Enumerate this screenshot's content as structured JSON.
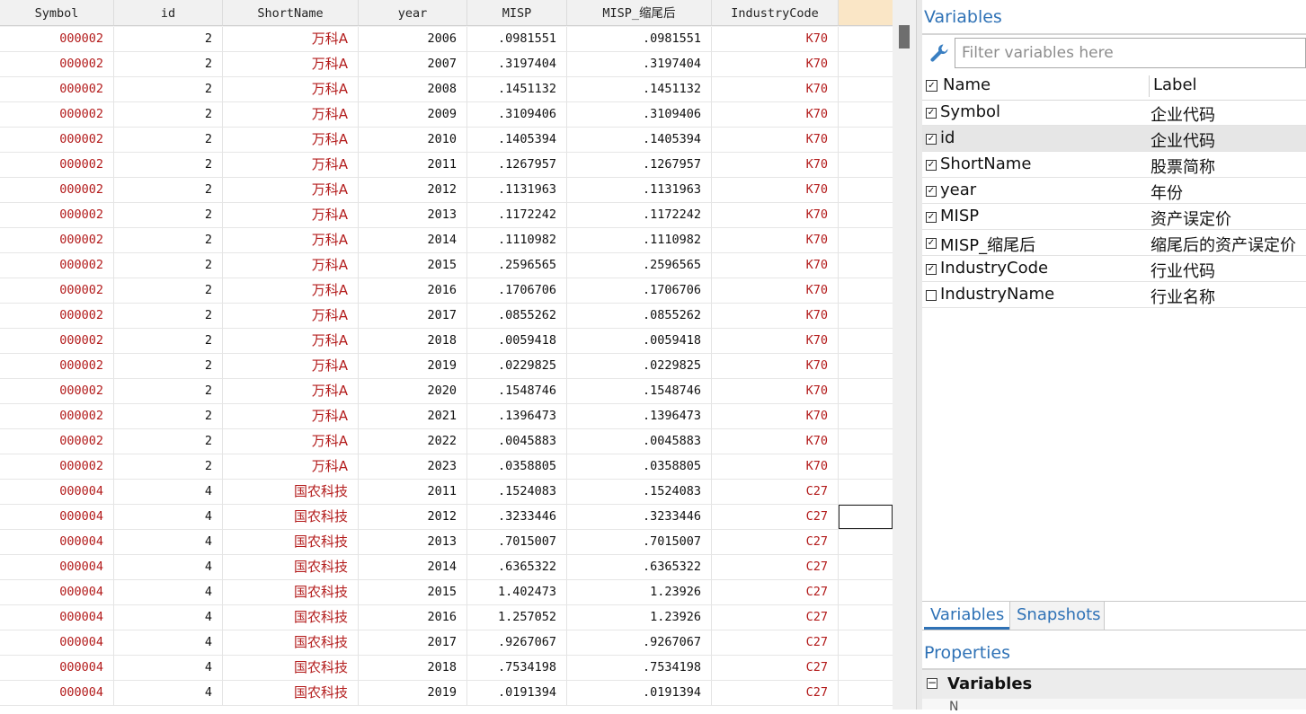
{
  "grid": {
    "columns": [
      {
        "key": "symbol",
        "label": "Symbol"
      },
      {
        "key": "id",
        "label": "id"
      },
      {
        "key": "shortname",
        "label": "ShortName"
      },
      {
        "key": "year",
        "label": "year"
      },
      {
        "key": "misp",
        "label": "MISP"
      },
      {
        "key": "misp_w",
        "label": "MISP_缩尾后"
      },
      {
        "key": "industrycode",
        "label": "IndustryCode"
      }
    ],
    "rows": [
      [
        "000002",
        "2",
        "万科A",
        "2006",
        ".0981551",
        ".0981551",
        "K70"
      ],
      [
        "000002",
        "2",
        "万科A",
        "2007",
        ".3197404",
        ".3197404",
        "K70"
      ],
      [
        "000002",
        "2",
        "万科A",
        "2008",
        ".1451132",
        ".1451132",
        "K70"
      ],
      [
        "000002",
        "2",
        "万科A",
        "2009",
        ".3109406",
        ".3109406",
        "K70"
      ],
      [
        "000002",
        "2",
        "万科A",
        "2010",
        ".1405394",
        ".1405394",
        "K70"
      ],
      [
        "000002",
        "2",
        "万科A",
        "2011",
        ".1267957",
        ".1267957",
        "K70"
      ],
      [
        "000002",
        "2",
        "万科A",
        "2012",
        ".1131963",
        ".1131963",
        "K70"
      ],
      [
        "000002",
        "2",
        "万科A",
        "2013",
        ".1172242",
        ".1172242",
        "K70"
      ],
      [
        "000002",
        "2",
        "万科A",
        "2014",
        ".1110982",
        ".1110982",
        "K70"
      ],
      [
        "000002",
        "2",
        "万科A",
        "2015",
        ".2596565",
        ".2596565",
        "K70"
      ],
      [
        "000002",
        "2",
        "万科A",
        "2016",
        ".1706706",
        ".1706706",
        "K70"
      ],
      [
        "000002",
        "2",
        "万科A",
        "2017",
        ".0855262",
        ".0855262",
        "K70"
      ],
      [
        "000002",
        "2",
        "万科A",
        "2018",
        ".0059418",
        ".0059418",
        "K70"
      ],
      [
        "000002",
        "2",
        "万科A",
        "2019",
        ".0229825",
        ".0229825",
        "K70"
      ],
      [
        "000002",
        "2",
        "万科A",
        "2020",
        ".1548746",
        ".1548746",
        "K70"
      ],
      [
        "000002",
        "2",
        "万科A",
        "2021",
        ".1396473",
        ".1396473",
        "K70"
      ],
      [
        "000002",
        "2",
        "万科A",
        "2022",
        ".0045883",
        ".0045883",
        "K70"
      ],
      [
        "000002",
        "2",
        "万科A",
        "2023",
        ".0358805",
        ".0358805",
        "K70"
      ],
      [
        "000004",
        "4",
        "国农科技",
        "2011",
        ".1524083",
        ".1524083",
        "C27"
      ],
      [
        "000004",
        "4",
        "国农科技",
        "2012",
        ".3233446",
        ".3233446",
        "C27"
      ],
      [
        "000004",
        "4",
        "国农科技",
        "2013",
        ".7015007",
        ".7015007",
        "C27"
      ],
      [
        "000004",
        "4",
        "国农科技",
        "2014",
        ".6365322",
        ".6365322",
        "C27"
      ],
      [
        "000004",
        "4",
        "国农科技",
        "2015",
        "1.402473",
        "1.23926",
        "C27"
      ],
      [
        "000004",
        "4",
        "国农科技",
        "2016",
        "1.257052",
        "1.23926",
        "C27"
      ],
      [
        "000004",
        "4",
        "国农科技",
        "2017",
        ".9267067",
        ".9267067",
        "C27"
      ],
      [
        "000004",
        "4",
        "国农科技",
        "2018",
        ".7534198",
        ".7534198",
        "C27"
      ],
      [
        "000004",
        "4",
        "国农科技",
        "2019",
        ".0191394",
        ".0191394",
        "C27"
      ]
    ]
  },
  "variables_pane": {
    "title": "Variables",
    "filter_placeholder": "Filter variables here",
    "header": {
      "name": "Name",
      "label": "Label",
      "checked": true
    },
    "items": [
      {
        "name": "Symbol",
        "label": "企业代码",
        "checked": true,
        "selected": false
      },
      {
        "name": "id",
        "label": "企业代码",
        "checked": true,
        "selected": true
      },
      {
        "name": "ShortName",
        "label": "股票简称",
        "checked": true,
        "selected": false
      },
      {
        "name": "year",
        "label": "年份",
        "checked": true,
        "selected": false
      },
      {
        "name": "MISP",
        "label": "资产误定价",
        "checked": true,
        "selected": false
      },
      {
        "name": "MISP_缩尾后",
        "label": "缩尾后的资产误定价",
        "checked": true,
        "selected": false
      },
      {
        "name": "IndustryCode",
        "label": "行业代码",
        "checked": true,
        "selected": false
      },
      {
        "name": "IndustryName",
        "label": "行业名称",
        "checked": false,
        "selected": false
      }
    ],
    "tabs": [
      {
        "label": "Variables",
        "active": true
      },
      {
        "label": "Snapshots",
        "active": false
      }
    ]
  },
  "properties_pane": {
    "title": "Properties",
    "section_label": "Variables",
    "section_collapse_glyph": "−",
    "partial_row_label": "N"
  },
  "colors": {
    "string_text": "#b31b1b",
    "pane_title": "#2f72b6",
    "header_bg": "#f1f1f1",
    "selected_column_header": "#fae6c6",
    "selected_row": "#e6e6e6"
  },
  "icons": {
    "filter_tool": "wrench-icon",
    "checkbox_checked": "☑",
    "checkbox_unchecked": "☐"
  }
}
